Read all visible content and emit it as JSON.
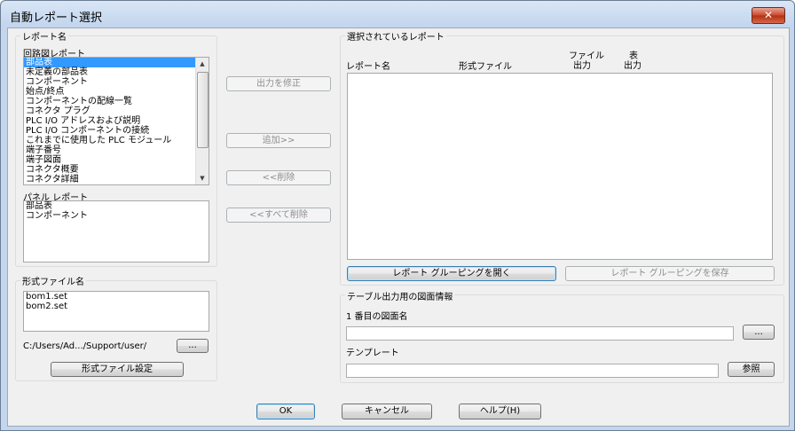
{
  "window": {
    "title": "自動レポート選択",
    "close_label": "✕"
  },
  "report_name_group": {
    "label": "レポート名",
    "circuit_label": "回路図レポート",
    "circuit_items": [
      "部品表",
      "未定義の部品表",
      "コンポーネント",
      "始点/終点",
      "コンポーネントの配線一覧",
      "コネクタ プラグ",
      "PLC I/O アドレスおよび説明",
      "PLC I/O コンポーネントの接続",
      "これまでに使用した PLC モジュール",
      "端子番号",
      "端子図面",
      "コネクタ概要",
      "コネクタ詳細"
    ],
    "panel_label": "パネル レポート",
    "panel_items": [
      "部品表",
      "コンポーネント"
    ]
  },
  "format_group": {
    "label": "形式ファイル名",
    "items": [
      "bom1.set",
      "bom2.set"
    ],
    "path": "C:/Users/Ad.../Support/user/",
    "browse_label": "...",
    "setting_label": "形式ファイル設定"
  },
  "middle_buttons": {
    "modify_output": "出力を修正",
    "add": "追加>>",
    "remove": "<<削除",
    "remove_all": "<<すべて削除"
  },
  "selected_group": {
    "label": "選択されているレポート",
    "col_report_name": "レポート名",
    "col_format_file": "形式ファイル",
    "col_file_output_1": "ファイル",
    "col_file_output_2": "出力",
    "col_table_output_1": "表",
    "col_table_output_2": "出力",
    "open_grouping": "レポート グルーピングを開く",
    "save_grouping": "レポート グルーピングを保存"
  },
  "table_group": {
    "label": "テーブル出力用の図面情報",
    "first_drawing_label": "1 番目の図面名",
    "first_drawing_value": "",
    "browse_label": "...",
    "template_label": "テンプレート",
    "template_value": "",
    "reference_label": "参照"
  },
  "footer": {
    "ok": "OK",
    "cancel": "キャンセル",
    "help": "ヘルプ(H)"
  }
}
